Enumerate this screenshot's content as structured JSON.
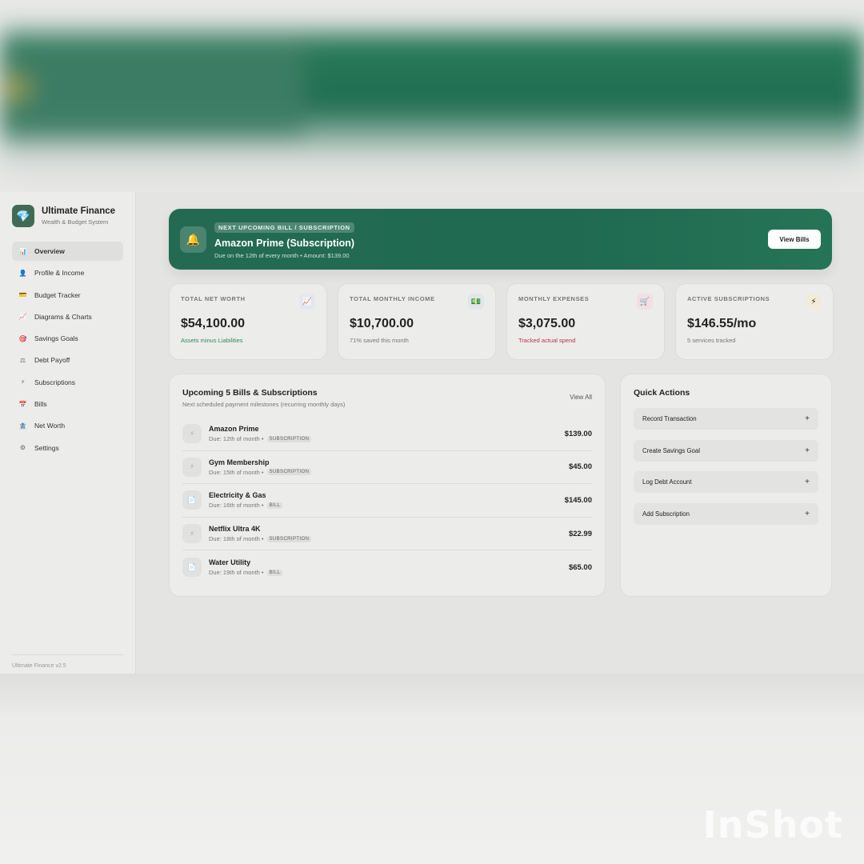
{
  "app": {
    "name": "Ultimate Finance",
    "tagline": "Wealth & Budget System",
    "version": "Ultimate Finance v2.5",
    "logo_icon": "gem-icon"
  },
  "sidebar": {
    "items": [
      {
        "label": "Overview",
        "icon": "bar-chart-icon",
        "glyph": "📊",
        "active": true
      },
      {
        "label": "Profile & Income",
        "icon": "user-icon",
        "glyph": "👤"
      },
      {
        "label": "Budget Tracker",
        "icon": "credit-card-icon",
        "glyph": "💳"
      },
      {
        "label": "Diagrams & Charts",
        "icon": "line-chart-icon",
        "glyph": "📈"
      },
      {
        "label": "Savings Goals",
        "icon": "target-icon",
        "glyph": "🎯"
      },
      {
        "label": "Debt Payoff",
        "icon": "scale-icon",
        "glyph": "⚖"
      },
      {
        "label": "Subscriptions",
        "icon": "lightning-icon",
        "glyph": "⚡"
      },
      {
        "label": "Bills",
        "icon": "calendar-icon",
        "glyph": "📅"
      },
      {
        "label": "Net Worth",
        "icon": "bank-icon",
        "glyph": "🏦"
      },
      {
        "label": "Settings",
        "icon": "gear-icon",
        "glyph": "⚙"
      }
    ]
  },
  "banner": {
    "tag": "NEXT UPCOMING BILL / SUBSCRIPTION",
    "title": "Amazon Prime (Subscription)",
    "subtitle": "Due on the 12th of every month • Amount: $139.00",
    "button": "View Bills",
    "icon": "bell-icon",
    "color": "#1f6a51"
  },
  "stats": [
    {
      "label": "TOTAL NET WORTH",
      "value": "$54,100.00",
      "note": "Assets minus Liabilities",
      "note_color": "#2e8b57",
      "icon": "chart-up-icon",
      "glyph": "📈",
      "icon_bg": "#e3e7ef"
    },
    {
      "label": "TOTAL MONTHLY INCOME",
      "value": "$10,700.00",
      "note": "71% saved this month",
      "note_color": "#777777",
      "icon": "money-icon",
      "glyph": "💵",
      "icon_bg": "#e2e6ec"
    },
    {
      "label": "MONTHLY EXPENSES",
      "value": "$3,075.00",
      "note": "Tracked actual spend",
      "note_color": "#c0304a",
      "icon": "cart-icon",
      "glyph": "🛒",
      "icon_bg": "#f1dfe4"
    },
    {
      "label": "ACTIVE SUBSCRIPTIONS",
      "value": "$146.55/mo",
      "note": "5 services tracked",
      "note_color": "#777777",
      "icon": "lightning-icon",
      "glyph": "⚡",
      "icon_bg": "#f1ecd9"
    }
  ],
  "bills": {
    "title": "Upcoming 5 Bills & Subscriptions",
    "subtitle": "Next scheduled payment milestones (recurring monthly days)",
    "view_all": "View All",
    "rows": [
      {
        "name": "Amazon Prime",
        "due": "Due: 12th of month •",
        "type": "SUBSCRIPTION",
        "amount": "$139.00",
        "icon": "lightning-icon",
        "glyph": "⚡"
      },
      {
        "name": "Gym Membership",
        "due": "Due: 15th of month •",
        "type": "SUBSCRIPTION",
        "amount": "$45.00",
        "icon": "lightning-icon",
        "glyph": "⚡"
      },
      {
        "name": "Electricity & Gas",
        "due": "Due: 16th of month •",
        "type": "BILL",
        "amount": "$145.00",
        "icon": "document-icon",
        "glyph": "📄"
      },
      {
        "name": "Netflix Ultra 4K",
        "due": "Due: 18th of month •",
        "type": "SUBSCRIPTION",
        "amount": "$22.99",
        "icon": "lightning-icon",
        "glyph": "⚡"
      },
      {
        "name": "Water Utility",
        "due": "Due: 19th of month •",
        "type": "BILL",
        "amount": "$65.00",
        "icon": "document-icon",
        "glyph": "📄"
      }
    ]
  },
  "quick_actions": {
    "title": "Quick Actions",
    "items": [
      {
        "label": "Record Transaction",
        "plus": "+"
      },
      {
        "label": "Create Savings Goal",
        "plus": "+"
      },
      {
        "label": "Log Debt Account",
        "plus": "+"
      },
      {
        "label": "Add Subscription",
        "plus": "+"
      }
    ]
  },
  "watermark": "InShot"
}
